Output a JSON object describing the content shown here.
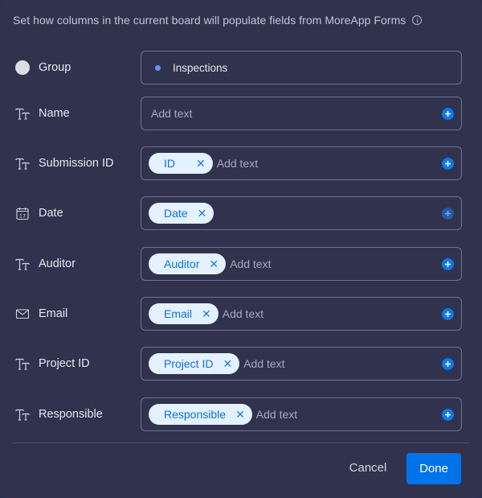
{
  "header": {
    "subtitle": "Set how columns in the current board will populate fields from MoreApp Forms",
    "info_icon": "info-icon"
  },
  "rows": [
    {
      "label": "Group",
      "icon": "group-dot-icon",
      "value": "Inspections",
      "value_color": "#579bfc"
    },
    {
      "label": "Name",
      "icon": "text-type-icon",
      "chip": null,
      "placeholder": "Add text",
      "add_enabled": true
    },
    {
      "label": "Submission ID",
      "icon": "text-type-icon",
      "chip": "ID",
      "placeholder": "Add text",
      "add_enabled": true
    },
    {
      "label": "Date",
      "icon": "calendar-icon",
      "calendar_day": "17",
      "chip": "Date",
      "placeholder": "",
      "add_enabled": false
    },
    {
      "label": "Auditor",
      "icon": "text-type-icon",
      "chip": "Auditor",
      "placeholder": "Add text",
      "add_enabled": true
    },
    {
      "label": "Email",
      "icon": "email-icon",
      "chip": "Email",
      "placeholder": "Add text",
      "add_enabled": true
    },
    {
      "label": "Project ID",
      "icon": "text-type-icon",
      "chip": "Project ID",
      "placeholder": "Add text",
      "add_enabled": true
    },
    {
      "label": "Responsible",
      "icon": "text-type-icon",
      "chip": "Responsible",
      "placeholder": "Add text",
      "add_enabled": true
    }
  ],
  "chip_remove_glyph": "✕",
  "footer": {
    "cancel_label": "Cancel",
    "done_label": "Done"
  },
  "colors": {
    "background": "#30324e",
    "accent": "#0073ea",
    "chip_bg": "#e4f1ff",
    "chip_text": "#0f73da"
  }
}
